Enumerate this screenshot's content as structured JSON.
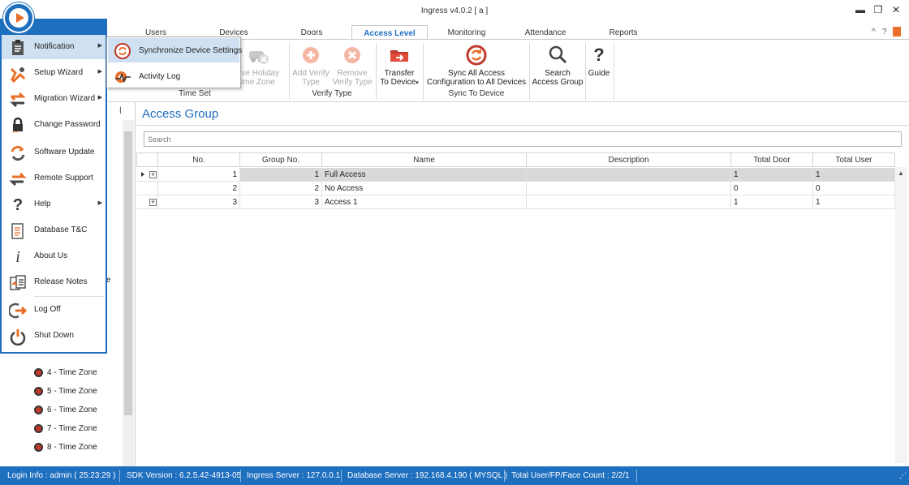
{
  "window": {
    "title": "Ingress v4.0.2 [ a ]",
    "minimize": "▬",
    "restore": "❐",
    "close": "✕",
    "collapse_ribbon": "^",
    "help_glyph": "?"
  },
  "tabs": [
    {
      "label": "Users"
    },
    {
      "label": "Devices"
    },
    {
      "label": "Doors"
    },
    {
      "label": "Access Level"
    },
    {
      "label": "Monitoring"
    },
    {
      "label": "Attendance"
    },
    {
      "label": "Reports"
    }
  ],
  "active_tab": "Access Level",
  "ribbon": {
    "remove_holiday_line1": "ove Holiday",
    "remove_holiday_line2": "ime Zone",
    "add_verify_line1": "Add Verify",
    "add_verify_line2": "Type",
    "remove_verify_line1": "Remove",
    "remove_verify_line2": "Verify Type",
    "transfer_line1": "Transfer",
    "transfer_line2": "To Device",
    "sync_line1": "Sync All Access",
    "sync_line2": "Configuration to All Devices",
    "search_line1": "Search",
    "search_line2": "Access Group",
    "guide_label": "Guide",
    "group_time_set": "Time Set",
    "group_verify_type": "Verify Type",
    "group_sync": "Sync To Device"
  },
  "app_menu": {
    "items": [
      {
        "label": "Notification",
        "icon": "clipboard-icon",
        "submenu": true
      },
      {
        "label": "Setup Wizard",
        "icon": "tools-icon",
        "submenu": true
      },
      {
        "label": "Migration Wizard",
        "icon": "migrate-arrows-icon",
        "submenu": true
      },
      {
        "label": "Change Password",
        "icon": "lock-icon",
        "submenu": false
      },
      {
        "label": "Software Update",
        "icon": "refresh-icon",
        "submenu": false
      },
      {
        "label": "Remote Support",
        "icon": "remote-arrows-icon",
        "submenu": false
      },
      {
        "label": "Help",
        "icon": "question-icon",
        "submenu": true
      },
      {
        "label": "Database T&C",
        "icon": "document-icon",
        "submenu": false
      },
      {
        "label": "About Us",
        "icon": "info-icon",
        "submenu": false
      },
      {
        "label": "Release Notes",
        "icon": "notes-icon",
        "submenu": false
      },
      {
        "label": "Log Off",
        "icon": "logoff-icon",
        "submenu": false
      },
      {
        "label": "Shut Down",
        "icon": "power-icon",
        "submenu": false
      }
    ]
  },
  "notification_submenu": [
    {
      "label": "Synchronize Device Settings"
    },
    {
      "label": "Activity Log"
    }
  ],
  "left_panel": {
    "pin": "ꟾ",
    "partial_glyph": "e",
    "time_zones": [
      {
        "label": "4 - Time Zone"
      },
      {
        "label": "5 - Time Zone"
      },
      {
        "label": "6 - Time Zone"
      },
      {
        "label": "7 - Time Zone"
      },
      {
        "label": "8 - Time Zone"
      }
    ]
  },
  "access_group": {
    "title": "Access Group",
    "search_placeholder": "Search",
    "columns": [
      "No.",
      "Group No.",
      "Name",
      "Description",
      "Total Door",
      "Total User"
    ],
    "rows": [
      {
        "no": "1",
        "group_no": "1",
        "name": "Full Access",
        "description": "",
        "total_door": "1",
        "total_user": "1",
        "expandable": true,
        "selected": true
      },
      {
        "no": "2",
        "group_no": "2",
        "name": "No Access",
        "description": "",
        "total_door": "0",
        "total_user": "0",
        "expandable": false,
        "selected": false
      },
      {
        "no": "3",
        "group_no": "3",
        "name": "Access 1",
        "description": "",
        "total_door": "1",
        "total_user": "1",
        "expandable": true,
        "selected": false
      }
    ]
  },
  "status_bar": {
    "login": "Login Info : admin ( 25:23:29 )",
    "sdk": "SDK Version : 6.2.5.42-4913-05",
    "server": "Ingress Server : 127.0.0.1",
    "database": "Database Server : 192.168.4.190 ( MYSQL )",
    "count": "Total User/FP/Face Count : 2/2/1"
  },
  "colors": {
    "accent": "#1f6fbf",
    "orange": "#e8702a",
    "selected_row": "#d9d9d9",
    "menu_hover": "#cfe0f2"
  }
}
